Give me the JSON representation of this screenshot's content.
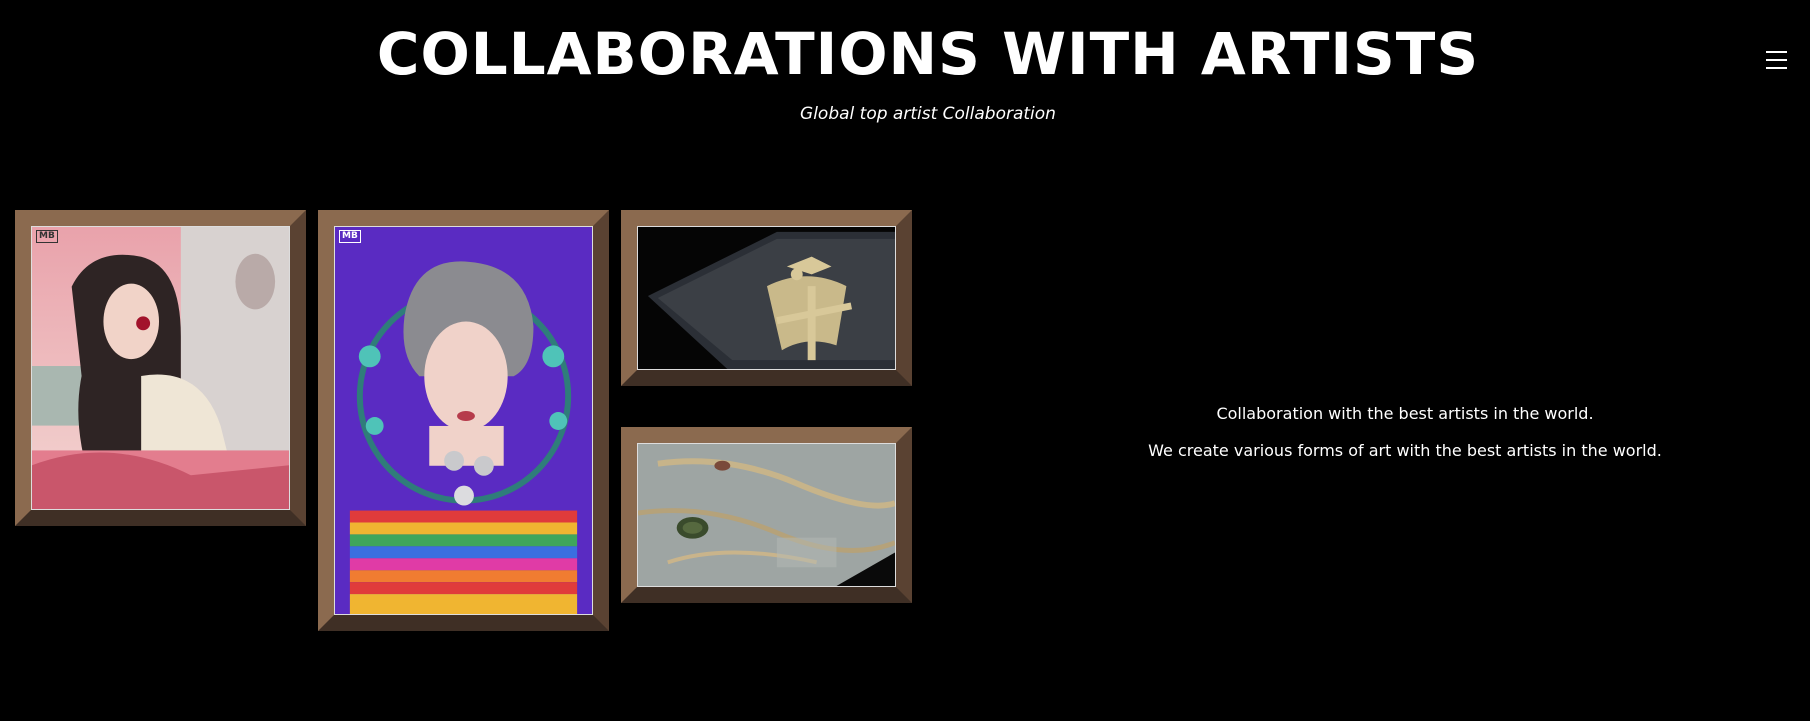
{
  "header": {
    "title": "COLLABORATIONS WITH ARTISTS",
    "subtitle": "Global top artist Collaboration"
  },
  "menu": {
    "icon": "hamburger-menu-icon"
  },
  "gallery": {
    "artworks": [
      {
        "name": "girl-with-cherry-illustration",
        "stamp": "MB"
      },
      {
        "name": "curly-hair-figure-illustration",
        "stamp": "MB"
      },
      {
        "name": "engraved-symbol-plate",
        "stamp": ""
      },
      {
        "name": "textured-surface-closeup",
        "stamp": ""
      }
    ]
  },
  "description": {
    "line1": "Collaboration with the best artists in the world.",
    "line2": "We create various forms of art with the best artists in the world."
  },
  "colors": {
    "background": "#000000",
    "text": "#ffffff",
    "frame": "#8b6a4f"
  }
}
